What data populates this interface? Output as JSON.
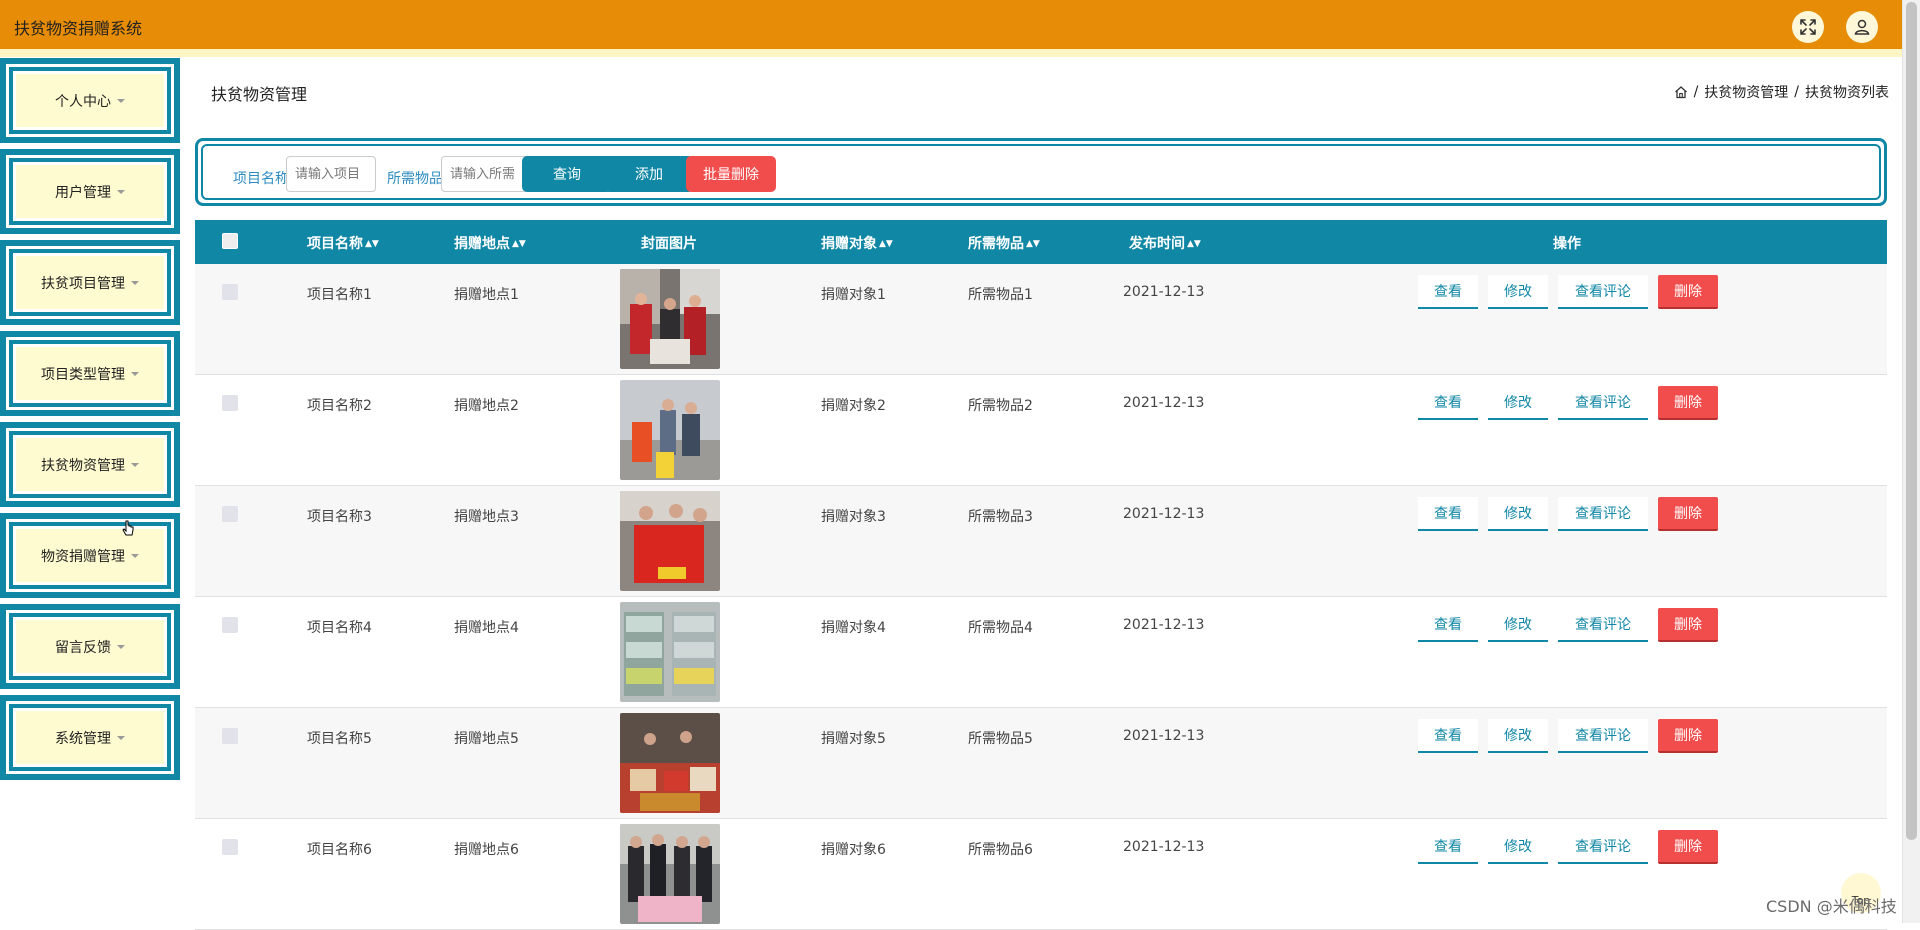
{
  "header": {
    "app_title": "扶贫物资捐赠系统",
    "colors": {
      "bar": "#e68c06",
      "accent": "#1187a6",
      "danger": "#f14d4d"
    },
    "icons": [
      "fullscreen-icon",
      "user-icon"
    ]
  },
  "sidebar": {
    "items": [
      {
        "label": "个人中心"
      },
      {
        "label": "用户管理"
      },
      {
        "label": "扶贫项目管理"
      },
      {
        "label": "项目类型管理"
      },
      {
        "label": "扶贫物资管理"
      },
      {
        "label": "物资捐赠管理"
      },
      {
        "label": "留言反馈"
      },
      {
        "label": "系统管理"
      }
    ]
  },
  "main": {
    "title": "扶贫物资管理",
    "breadcrumb": {
      "home_icon": "home-icon",
      "sep": "/",
      "level1": "扶贫物资管理",
      "level2": "扶贫物资列表"
    }
  },
  "search": {
    "name_label": "项目名称",
    "name_placeholder": "请输入项目",
    "item_label": "所需物品",
    "item_placeholder": "请输入所需",
    "query_label": "查询",
    "add_label": "添加",
    "batch_delete_label": "批量删除"
  },
  "table": {
    "columns": {
      "name": "项目名称",
      "location": "捐赠地点",
      "cover": "封面图片",
      "target": "捐赠对象",
      "items": "所需物品",
      "time": "发布时间",
      "ops": "操作"
    },
    "actions": {
      "view": "查看",
      "edit": "修改",
      "comments": "查看评论",
      "delete": "删除"
    },
    "rows": [
      {
        "name": "项目名称1",
        "location": "捐赠地点1",
        "target": "捐赠对象1",
        "items": "所需物品1",
        "time": "2021-12-13"
      },
      {
        "name": "项目名称2",
        "location": "捐赠地点2",
        "target": "捐赠对象2",
        "items": "所需物品2",
        "time": "2021-12-13"
      },
      {
        "name": "项目名称3",
        "location": "捐赠地点3",
        "target": "捐赠对象3",
        "items": "所需物品3",
        "time": "2021-12-13"
      },
      {
        "name": "项目名称4",
        "location": "捐赠地点4",
        "target": "捐赠对象4",
        "items": "所需物品4",
        "time": "2021-12-13"
      },
      {
        "name": "项目名称5",
        "location": "捐赠地点5",
        "target": "捐赠对象5",
        "items": "所需物品5",
        "time": "2021-12-13"
      },
      {
        "name": "项目名称6",
        "location": "捐赠地点6",
        "target": "捐赠对象6",
        "items": "所需物品6",
        "time": "2021-12-13"
      }
    ]
  },
  "footer": {
    "top_label": "Top",
    "watermark": "CSDN @米偶科技"
  }
}
